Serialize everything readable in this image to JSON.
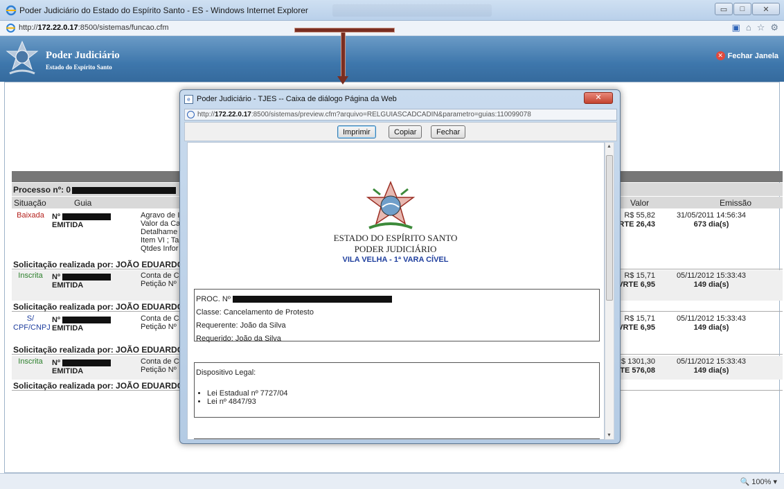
{
  "window": {
    "title": "Poder Judiciário do Estado do Espírito Santo - ES - Windows Internet Explorer",
    "url_prefix": "http://",
    "url_host": "172.22.0.17",
    "url_rest": ":8500/sistemas/funcao.cfm",
    "controls": {
      "minimize": "▭",
      "maximize": "□",
      "close": "✕"
    }
  },
  "header": {
    "title": "Poder Judiciário",
    "subtitle": "Estado do Espírito Santo",
    "close_window": "Fechar Janela"
  },
  "process": {
    "label": "Processo nº:",
    "prefix": "0",
    "columns": {
      "situacao": "Situação",
      "guia": "Guia",
      "valor": "Valor",
      "emissao": "Emissão"
    },
    "rows": [
      {
        "situacao": "Baixada",
        "guia_prefix": "Nº",
        "guia_status": "EMITIDA",
        "desc": [
          "Agravo de I",
          "Valor da Ca",
          "Detalhame",
          "Item VI ; Ta",
          "Qtdes Infor"
        ],
        "valor": "R$ 55,82",
        "vrte": "VRTE 26,43",
        "emissao_date": "31/05/2011 14:56:34",
        "emissao_days": "673 dia(s)",
        "solicitacao": "Solicitação realizada por: JOÃO EDUARDO C"
      },
      {
        "situacao": "Inscrita",
        "guia_prefix": "Nº",
        "guia_status": "EMITIDA",
        "desc": [
          "Conta de C",
          "Petição Nº"
        ],
        "valor": "R$ 15,71",
        "vrte": "VRTE 6,95",
        "emissao_date": "05/11/2012 15:33:43",
        "emissao_days": "149 dia(s)",
        "solicitacao": "Solicitação realizada por: JOÃO EDUARDO C"
      },
      {
        "situacao": "S/ CPF/CNPJ",
        "situacao_l1": "S/",
        "situacao_l2": "CPF/CNPJ",
        "guia_prefix": "Nº",
        "guia_status": "EMITIDA",
        "desc": [
          "Conta de C",
          "Petição Nº"
        ],
        "valor": "R$ 15,71",
        "vrte": "VRTE 6,95",
        "emissao_date": "05/11/2012 15:33:43",
        "emissao_days": "149 dia(s)",
        "solicitacao": "Solicitação realizada por: JOÃO EDUARDO C"
      },
      {
        "situacao": "Inscrita",
        "guia_prefix": "Nº",
        "guia_status": "EMITIDA",
        "desc": [
          "Conta de C",
          "Petição Nº"
        ],
        "valor": "R$ 1301,30",
        "vrte": "VRTE 576,08",
        "emissao_date": "05/11/2012 15:33:43",
        "emissao_days": "149 dia(s)",
        "solicitacao": "Solicitação realizada por: JOÃO EDUARDO C"
      }
    ]
  },
  "dialog": {
    "title": "Poder Judiciário - TJES -- Caixa de diálogo Página da Web",
    "url_prefix": "http://",
    "url_host": "172.22.0.17",
    "url_rest": ":8500/sistemas/preview.cfm?arquivo=RELGUIASCADCADIN&parametro=guias:110099078",
    "buttons": {
      "print": "Imprimir",
      "copy": "Copiar",
      "close": "Fechar"
    },
    "doc": {
      "state": "ESTADO DO ESPÍRITO SANTO",
      "judiciary": "PODER JUDICIÁRIO",
      "vara": "VILA VELHA - 1ª VARA CÍVEL",
      "proc_label": "PROC. Nº",
      "classe": "Classe: Cancelamento de Protesto",
      "requerente": "Requerente: João da Silva",
      "requerido": "Requerido: João da Silva",
      "dispositivo_label": "Dispositivo Legal:",
      "leis": [
        "Lei Estadual nº 7727/04",
        "Lei nº 4847/93"
      ]
    }
  },
  "status": {
    "zoom": "100%"
  },
  "colors": {
    "header_blue": "#3e77ac",
    "baixada": "#b5221e",
    "inscrita": "#2a7f2a",
    "cpf": "#1f3f9e"
  }
}
